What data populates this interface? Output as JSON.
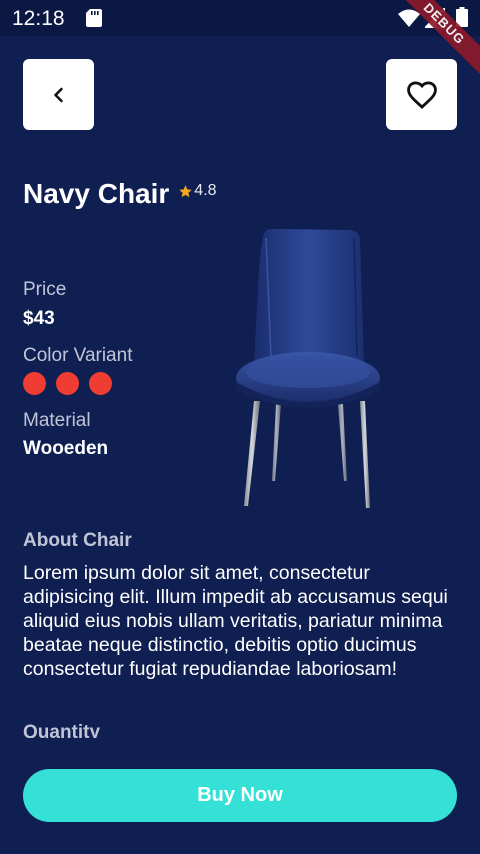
{
  "status_bar": {
    "time": "12:18",
    "debug_label": "DEBUG"
  },
  "product": {
    "title": "Navy Chair",
    "rating": "4.8",
    "price_label": "Price",
    "price_value": "$43",
    "color_label": "Color Variant",
    "color_variants": [
      "#f03d33",
      "#f03d33",
      "#f03d33"
    ],
    "material_label": "Material",
    "material_value": "Wooeden"
  },
  "about": {
    "heading": "About Chair",
    "text": "Lorem ipsum dolor sit amet, consectetur adipisicing elit. Illum impedit ab accusamus sequi aliquid eius nobis ullam veritatis, pariatur minima beatae neque distinctio, debitis optio ducimus consectetur fugiat repudiandae laboriosam!",
    "quantity_label": "Quantity"
  },
  "actions": {
    "buy_label": "Buy Now"
  },
  "colors": {
    "background": "#101f51",
    "accent": "#35e0d7",
    "star": "#f5a623",
    "variant_dot": "#f03d33"
  },
  "icons": {
    "back": "chevron-left-icon",
    "favorite": "heart-outline-icon",
    "rating": "star-icon"
  }
}
